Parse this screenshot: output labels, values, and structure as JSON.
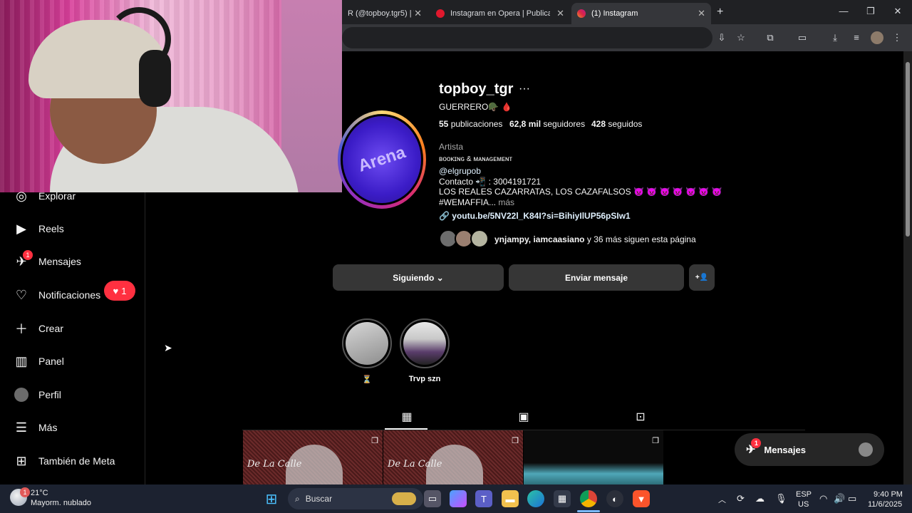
{
  "browser": {
    "tabs": [
      {
        "title": "R (@topboy.tgr5) | T",
        "active": false
      },
      {
        "title": "Instagram en Opera | Publicar,",
        "active": false
      },
      {
        "title": "(1) Instagram",
        "active": true
      }
    ],
    "new_tab_label": "+"
  },
  "sidebar": {
    "items": [
      {
        "label": "Explorar",
        "icon": "compass-icon"
      },
      {
        "label": "Reels",
        "icon": "reels-icon"
      },
      {
        "label": "Mensajes",
        "icon": "messenger-icon",
        "badge": "1"
      },
      {
        "label": "Notificaciones",
        "icon": "heart-icon"
      },
      {
        "label": "Crear",
        "icon": "plus-icon"
      },
      {
        "label": "Panel",
        "icon": "dashboard-icon"
      },
      {
        "label": "Perfil",
        "icon": "avatar-icon"
      },
      {
        "label": "Más",
        "icon": "menu-icon"
      },
      {
        "label": "También de Meta",
        "icon": "meta-icon"
      }
    ],
    "notif_pill_count": "1"
  },
  "profile": {
    "avatar_text": "Arena",
    "username": "topboy_tgr",
    "more": "···",
    "display_name": "GUERRERO🪖 🩸",
    "stats": {
      "posts_num": "55",
      "posts_label": "publicaciones",
      "followers_num": "62,8 mil",
      "followers_label": "seguidores",
      "following_num": "428",
      "following_label": "seguidos"
    },
    "category": "Artista",
    "bio_line1": "ʙᴏᴏᴋɪɴɢ & ᴍᴀɴᴀɢᴇᴍᴇɴᴛ",
    "bio_mention": "@elgrupob",
    "bio_contact": "Contacto 📲 : 3004191721",
    "bio_line3": "LOS REALES CAZARRATAS, LOS CAZAFALSOS 👿 👿 👿 👿 👿 👿 👿",
    "bio_line4": "#WEMAFFIA...",
    "bio_more": "más",
    "link": "youtu.be/5NV22l_K84I?si=BihiyIlUP56pSIw1",
    "followed_by_names": "ynjampy, iamcaasiano",
    "followed_by_rest": "y 36 más siguen esta página"
  },
  "actions": {
    "following": "Siguiendo",
    "message": "Enviar mensaje",
    "add_person": "+👤"
  },
  "highlights": [
    {
      "label": "⏳"
    },
    {
      "label": "Trvp szn"
    }
  ],
  "grid": {
    "post1_text": "De La Calle",
    "post2_text": "De La Calle"
  },
  "floating_messages": {
    "label": "Mensajes",
    "badge": "1"
  },
  "taskbar": {
    "weather_temp": "21°C",
    "weather_desc": "Mayorm. nublado",
    "weather_badge": "1",
    "search_placeholder": "Buscar",
    "lang_top": "ESP",
    "lang_bottom": "US",
    "time": "9:40 PM",
    "date": "11/6/2025"
  }
}
